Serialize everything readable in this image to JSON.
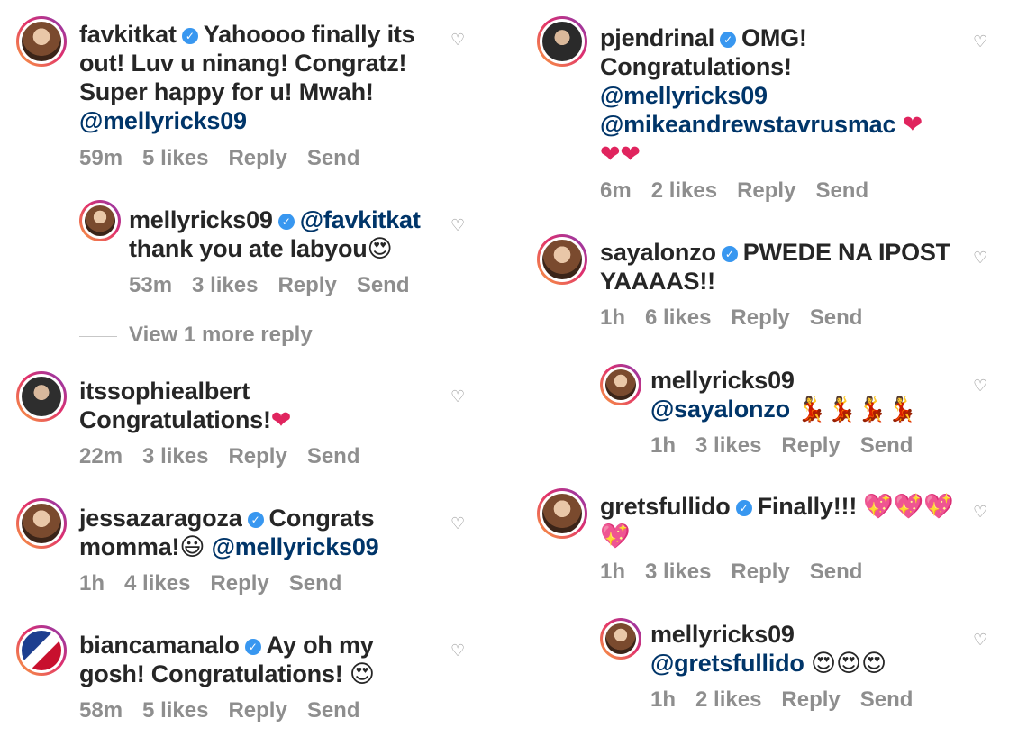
{
  "left": [
    {
      "user": "favkitkat",
      "verified": true,
      "text": "Yahoooo finally its out! Luv u ninang! Congratz! Super happy for u! Mwah!",
      "mention": "@mellyricks09",
      "time": "59m",
      "likes": "5 likes",
      "reply": "Reply",
      "send": "Send"
    },
    {
      "user": "mellyricks09",
      "verified": true,
      "mention_pre": "@favkitkat",
      "text": "thank you ate labyou",
      "emoji": "😍",
      "time": "53m",
      "likes": "3 likes",
      "reply": "Reply",
      "send": "Send"
    },
    {
      "user": "itssophiealbert",
      "verified": false,
      "text": "Congratulations!",
      "emoji": "❤",
      "time": "22m",
      "likes": "3 likes",
      "reply": "Reply",
      "send": "Send"
    },
    {
      "user": "jessazaragoza",
      "verified": true,
      "text": "Congrats momma!",
      "emoji": "😃",
      "mention": "@mellyricks09",
      "time": "1h",
      "likes": "4 likes",
      "reply": "Reply",
      "send": "Send"
    },
    {
      "user": "biancamanalo",
      "verified": true,
      "text": "Ay oh my gosh! Congratulations!",
      "emoji": "😍",
      "time": "58m",
      "likes": "5 likes",
      "reply": "Reply",
      "send": "Send"
    }
  ],
  "view_more": "View 1 more reply",
  "right": [
    {
      "user": "pjendrinal",
      "verified": true,
      "text": "OMG! Congratulations!",
      "mention": "@mellyricks09",
      "mention2": "@mikeandrewstavrusmac",
      "emoji": "❤",
      "emoji2": "❤❤",
      "time": "6m",
      "likes": "2 likes",
      "reply": "Reply",
      "send": "Send"
    },
    {
      "user": "sayalonzo",
      "verified": true,
      "text": "PWEDE NA IPOST YAAAAS!!",
      "time": "1h",
      "likes": "6 likes",
      "reply": "Reply",
      "send": "Send"
    },
    {
      "user": "mellyricks09",
      "verified": false,
      "mention": "@sayalonzo",
      "emoji": "💃💃💃💃",
      "time": "1h",
      "likes": "3 likes",
      "reply": "Reply",
      "send": "Send"
    },
    {
      "user": "gretsfullido",
      "verified": true,
      "text": "Finally!!!",
      "emoji": "💖💖💖",
      "emoji2": "💖",
      "time": "1h",
      "likes": "3 likes",
      "reply": "Reply",
      "send": "Send"
    },
    {
      "user": "mellyricks09",
      "verified": false,
      "mention": "@gretsfullido",
      "emoji": "😍😍😍",
      "time": "1h",
      "likes": "2 likes",
      "reply": "Reply",
      "send": "Send"
    }
  ],
  "icons": {
    "heart": "heart-outline-icon",
    "verified": "verified-badge-icon"
  }
}
